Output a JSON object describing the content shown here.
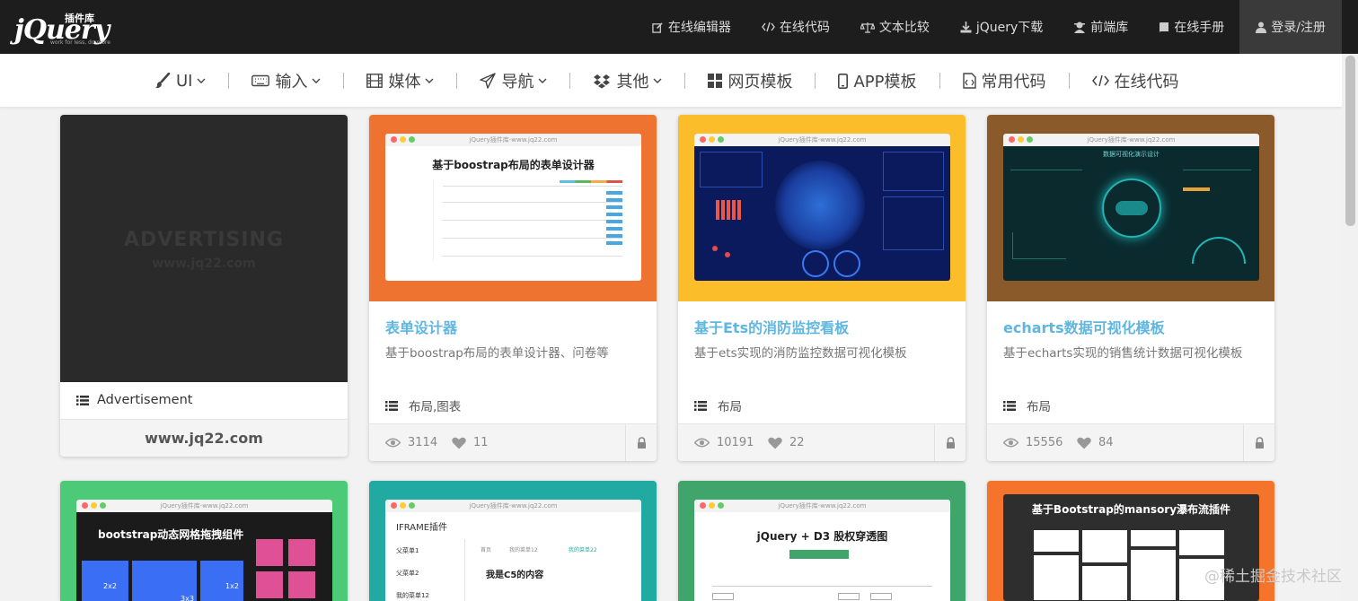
{
  "header": {
    "logo_text": "jQuery",
    "logo_cn": "插件库",
    "logo_tagline": "work for less, do more",
    "nav": [
      {
        "label": "在线编辑器",
        "icon": "edit-icon"
      },
      {
        "label": "在线代码",
        "icon": "code-icon"
      },
      {
        "label": "文本比较",
        "icon": "balance-icon"
      },
      {
        "label": "jQuery下载",
        "icon": "download-icon"
      },
      {
        "label": "前端库",
        "icon": "user-secret-icon"
      },
      {
        "label": "在线手册",
        "icon": "book-icon"
      }
    ],
    "login_label": "登录/注册"
  },
  "category_nav": [
    {
      "label": "UI",
      "icon": "paint-brush-icon",
      "dropdown": true
    },
    {
      "label": "输入",
      "icon": "keyboard-icon",
      "dropdown": true
    },
    {
      "label": "媒体",
      "icon": "film-icon",
      "dropdown": true
    },
    {
      "label": "导航",
      "icon": "paper-plane-icon",
      "dropdown": true
    },
    {
      "label": "其他",
      "icon": "dropbox-icon",
      "dropdown": true
    },
    {
      "label": "网页模板",
      "icon": "grid-icon",
      "dropdown": false
    },
    {
      "label": "APP模板",
      "icon": "mobile-icon",
      "dropdown": false
    },
    {
      "label": "常用代码",
      "icon": "file-code-icon",
      "dropdown": false
    },
    {
      "label": "在线代码",
      "icon": "code-icon",
      "dropdown": false
    }
  ],
  "ad_card": {
    "image_text": "ADVERTISING",
    "image_subtext": "www.jq22.com",
    "label": "Advertisement",
    "footer_text": "www.jq22.com"
  },
  "cards": [
    {
      "title": "表单设计器",
      "description": "基于boostrap布局的表单设计器、问卷等",
      "tags": "布局,图表",
      "views": "3114",
      "likes": "11",
      "bg_color": "#ef7330",
      "preview_url": "jQuery插件库-www.jq22.com",
      "preview_title": "基于boostrap布局的表单设计器"
    },
    {
      "title": "基于Ets的消防监控看板",
      "description": "基于ets实现的消防监控数据可视化模板",
      "tags": "布局",
      "views": "10191",
      "likes": "22",
      "bg_color": "#fbbd2a",
      "preview_url": "jQuery插件库-www.jq22.com"
    },
    {
      "title": "echarts数据可视化模板",
      "description": "基于echarts实现的销售统计数据可视化模板",
      "tags": "布局",
      "views": "15556",
      "likes": "84",
      "bg_color": "#8b5a2b",
      "preview_url": "jQuery插件库-www.jq22.com",
      "preview_title": "数据可视化演示设计"
    }
  ],
  "row2_cards": [
    {
      "bg_color": "#4cca78",
      "preview_url": "jQuery插件库-www.jq22.com",
      "preview_title": "bootstrap动态网格拖拽组件",
      "cell_a": "2x2",
      "cell_b": "3x3",
      "cell_c": "1x2"
    },
    {
      "bg_color": "#21aaa2",
      "preview_url": "jQuery插件库-www.jq22.com",
      "preview_title": "IFRAME插件",
      "menu1": "父菜单1",
      "menu2": "父菜单2",
      "menu3": "我的菜单12",
      "tab1": "首页",
      "tab2": "我的菜单12",
      "tab3": "我的菜单22",
      "content": "我是C5的内容"
    },
    {
      "bg_color": "#3fa56b",
      "preview_url": "jQuery插件库-www.jq22.com",
      "preview_title": "jQuery + D3 股权穿透图"
    },
    {
      "bg_color": "#f5742c",
      "preview_title": "基于Bootstrap的mansory瀑布流插件"
    }
  ],
  "watermark": "@稀土掘金技术社区",
  "colors": {
    "topbar": "#1d1d1d",
    "title_link": "#5fb6e0"
  }
}
